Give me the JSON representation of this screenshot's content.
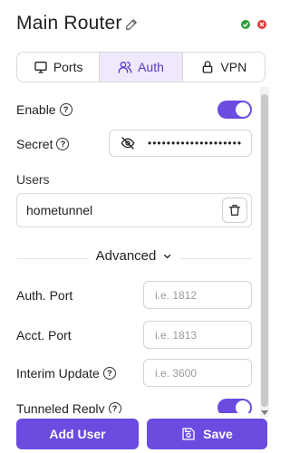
{
  "header": {
    "title": "Main Router"
  },
  "tabs": [
    {
      "label": "Ports",
      "icon": "monitor-icon",
      "active": false
    },
    {
      "label": "Auth",
      "icon": "users-icon",
      "active": true
    },
    {
      "label": "VPN",
      "icon": "lock-icon",
      "active": false
    }
  ],
  "auth": {
    "enable_label": "Enable",
    "enable_on": true,
    "secret_label": "Secret",
    "secret_value": "••••••••••••••••••••",
    "users_label": "Users",
    "users": [
      "hometunnel"
    ],
    "advanced_label": "Advanced",
    "auth_port_label": "Auth. Port",
    "auth_port_placeholder": "i.e. 1812",
    "acct_port_label": "Acct. Port",
    "acct_port_placeholder": "i.e. 1813",
    "interim_label": "Interim Update",
    "interim_placeholder": "i.e. 3600",
    "tunneled_label": "Tunneled Reply",
    "tunneled_on": true
  },
  "footer": {
    "add_user_label": "Add User",
    "save_label": "Save"
  },
  "colors": {
    "accent": "#6b4be0",
    "active_tab_bg": "#efe9fb",
    "status_green": "#2e9e3a",
    "status_red": "#e23a3a"
  }
}
